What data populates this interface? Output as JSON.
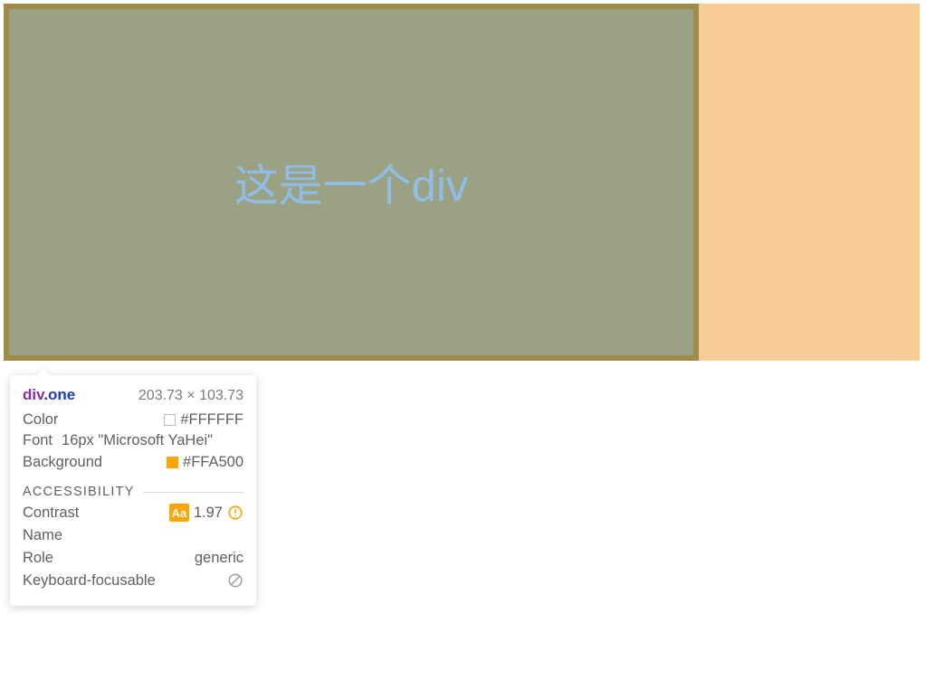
{
  "inspected": {
    "text": "这是一个div"
  },
  "tooltip": {
    "selector": {
      "tag": "div",
      "cls": ".one"
    },
    "dimensions": "203.73 × 103.73",
    "rows": {
      "color": {
        "label": "Color",
        "value": "#FFFFFF"
      },
      "font": {
        "label": "Font",
        "value": "16px \"Microsoft YaHei\""
      },
      "background": {
        "label": "Background",
        "value": "#FFA500"
      }
    },
    "accessibility": {
      "title": "ACCESSIBILITY",
      "contrast": {
        "label": "Contrast",
        "badge": "Aa",
        "value": "1.97"
      },
      "name": {
        "label": "Name",
        "value": ""
      },
      "role": {
        "label": "Role",
        "value": "generic"
      },
      "keyboard": {
        "label": "Keyboard-focusable"
      }
    }
  }
}
